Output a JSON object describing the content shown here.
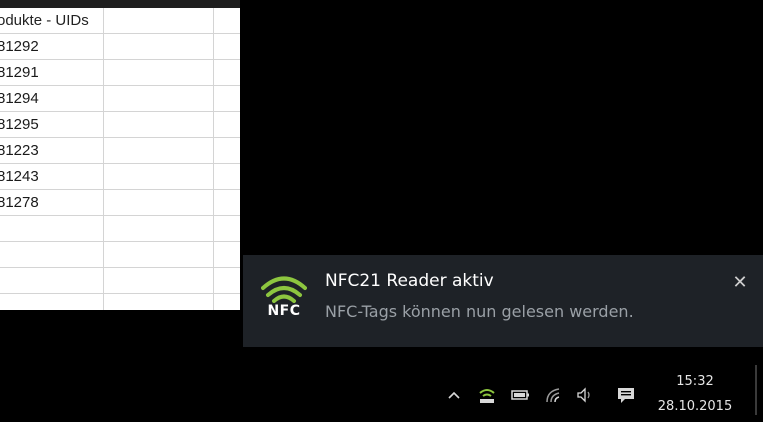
{
  "spreadsheet": {
    "header": "odukte - UIDs",
    "rows": [
      "81292",
      "81291",
      "81294",
      "81295",
      "81223",
      "81243",
      "81278",
      "",
      "",
      "",
      ""
    ]
  },
  "toast": {
    "icon_label": "NFC",
    "title": "NFC21 Reader aktiv",
    "body": "NFC-Tags können nun gelesen werden.",
    "close_glyph": "✕",
    "accent_color": "#8dc63f"
  },
  "tray": {
    "time": "15:32",
    "date": "28.10.2015",
    "icons": [
      "chevron-up-icon",
      "nfc-reader-icon",
      "battery-icon",
      "network-icon",
      "volume-icon",
      "action-center-icon"
    ]
  }
}
